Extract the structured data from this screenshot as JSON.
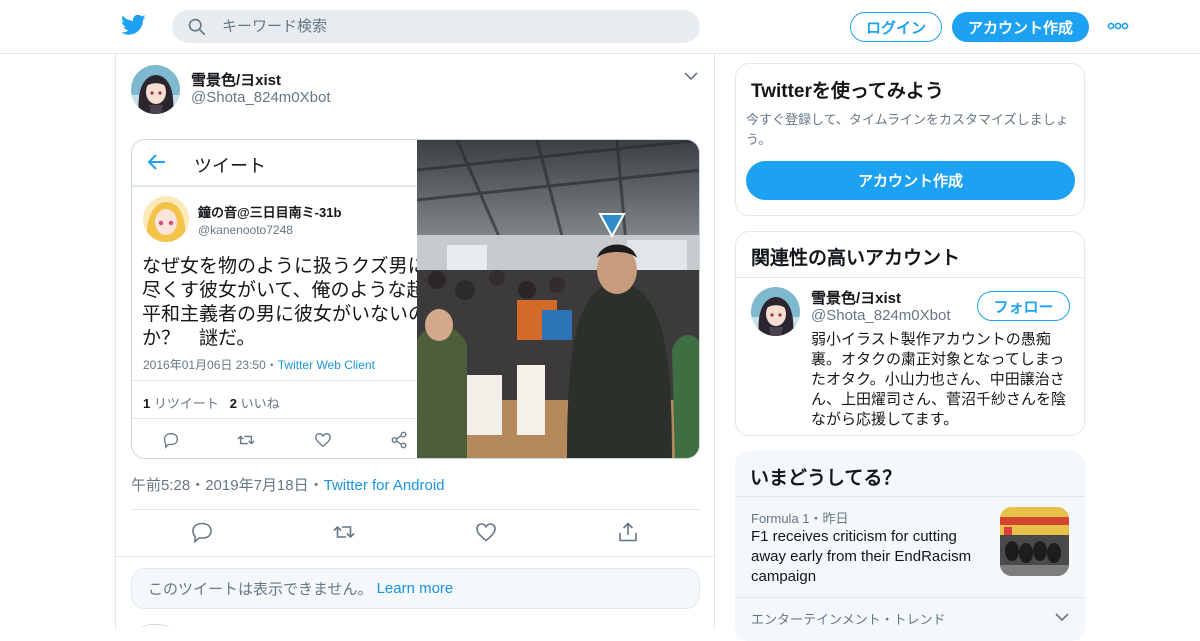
{
  "header": {
    "search_placeholder": "キーワード検索",
    "login_label": "ログイン",
    "signup_label": "アカウント作成"
  },
  "tweet": {
    "display_name": "雪景色/ヨxist",
    "handle": "@Shota_824m0Xbot",
    "media_screenshot": {
      "header_title": "ツイート",
      "name": "鐘の音@三日目南ミ-31b",
      "handle": "@kanenooto7248",
      "text": "なぜ女を物のように扱うクズ男に\n尽くす彼女がいて、俺のような超\n平和主義者の男に彼女がいないの\nか？　謎だ。",
      "meta_time": "2016年01月06日 23:50・",
      "meta_client": "Twitter Web Client",
      "retweet_count": "1",
      "retweet_label": "リツイート",
      "like_count": "2",
      "like_label": "いいね"
    },
    "time": "午前5:28",
    "sep": "・",
    "date": "2019年7月18日",
    "client": "Twitter for Android",
    "unavailable_text": "このツイートは表示できません。",
    "learn_more": "Learn more"
  },
  "sidebar": {
    "signup_card": {
      "title": "Twitterを使ってみよう",
      "desc": "今すぐ登録して、タイムラインをカスタマイズしましょう。",
      "button": "アカウント作成"
    },
    "related": {
      "title": "関連性の高いアカウント",
      "name": "雪景色/ヨxist",
      "handle": "@Shota_824m0Xbot",
      "follow": "フォロー",
      "bio": "弱小イラスト製作アカウントの愚痴裏。オタクの粛正対象となってしまったオタク。小山力也さん、中田譲治さん、上田燿司さん、菅沼千紗さんを陰ながら応援してます。"
    },
    "trends": {
      "title": "いまどうしてる？",
      "item1_category": "Formula 1",
      "item1_sep": "・",
      "item1_time": "昨日",
      "item1_headline": "F1 receives criticism for cutting away early from their EndRacism campaign",
      "item2_meta": "エンターテインメント・トレンド"
    }
  },
  "colors": {
    "accent": "#1da1f2",
    "link": "#1b95e0",
    "muted": "#657786",
    "border": "#e1e8ed"
  }
}
